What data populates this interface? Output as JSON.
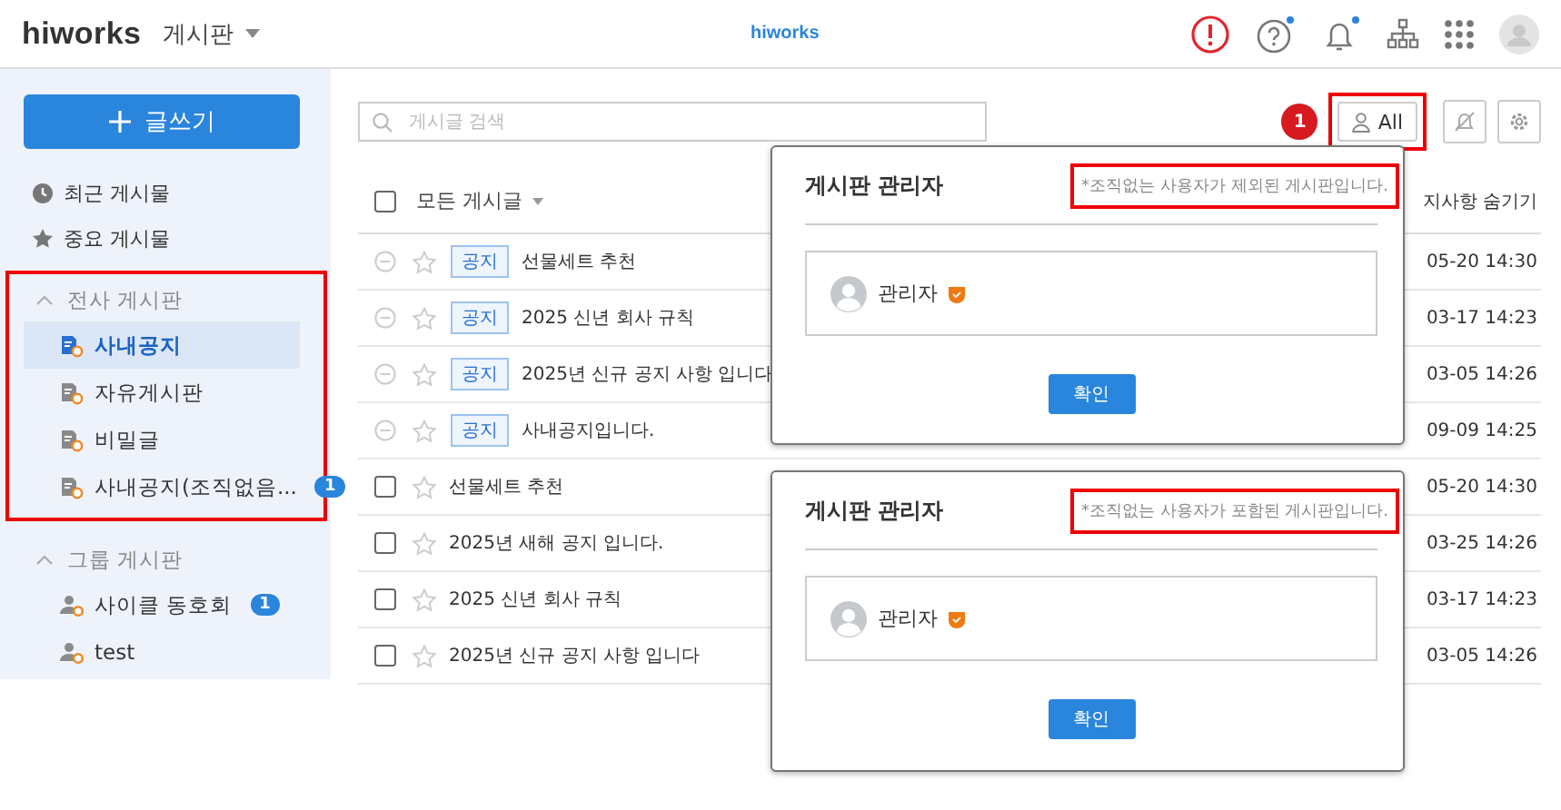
{
  "header": {
    "logo": "hiworks",
    "app_menu": "게시판",
    "center_logo": "hiworks",
    "icons": [
      {
        "kind": "alert"
      },
      {
        "kind": "help",
        "dot": true
      },
      {
        "kind": "bell",
        "dot": true
      },
      {
        "kind": "org"
      },
      {
        "kind": "apps"
      },
      {
        "kind": "avatar"
      }
    ]
  },
  "sidebar": {
    "write_button": "글쓰기",
    "shortcuts": [
      {
        "kind": "recent",
        "label": "최근 게시물"
      },
      {
        "kind": "important",
        "label": "중요 게시물"
      }
    ],
    "groups": [
      {
        "label": "전사 게시판",
        "expanded": true,
        "highlighted": true,
        "children": [
          {
            "kind": "board",
            "label": "사내공지",
            "selected": true
          },
          {
            "kind": "board",
            "label": "자유게시판",
            "selected": false
          },
          {
            "kind": "board",
            "label": "비밀글",
            "selected": false
          },
          {
            "kind": "board",
            "label": "사내공지(조직없음...",
            "selected": false,
            "badge": "1"
          }
        ]
      },
      {
        "label": "그룹 게시판",
        "expanded": true,
        "highlighted": false,
        "children": [
          {
            "kind": "group",
            "label": "사이클 동호회",
            "selected": false,
            "badge": "1"
          },
          {
            "kind": "group",
            "label": "test",
            "selected": false
          }
        ]
      }
    ]
  },
  "toolbar": {
    "search": {
      "placeholder": "게시글 검색"
    },
    "step_badge": "1",
    "all_button": {
      "label": "All",
      "highlighted": true
    }
  },
  "table": {
    "filter": "모든 게시글",
    "all_checked": false,
    "column_right": "지사항 숨기기",
    "rows": [
      {
        "kind": "notice",
        "tag": "공지",
        "title": "선물세트 추천",
        "date": "05-20 14:30"
      },
      {
        "kind": "notice",
        "tag": "공지",
        "title": "2025 신년 회사 규칙",
        "date": "03-17 14:23"
      },
      {
        "kind": "notice",
        "tag": "공지",
        "title": "2025년 신규 공지 사항 입니다",
        "date": "03-05 14:26"
      },
      {
        "kind": "notice",
        "tag": "공지",
        "title": "사내공지입니다.",
        "date": "09-09 14:25"
      },
      {
        "kind": "normal",
        "checked": false,
        "title": "선물세트 추천",
        "date": "05-20 14:30"
      },
      {
        "kind": "normal",
        "checked": false,
        "title": "2025년 새해 공지 입니다.",
        "date": "03-25 14:26"
      },
      {
        "kind": "normal",
        "checked": false,
        "title": "2025 신년 회사 규칙",
        "date": "03-17 14:23"
      },
      {
        "kind": "normal",
        "checked": false,
        "title": "2025년 신규 공지 사항 입니다",
        "date": "03-05 14:26"
      }
    ]
  },
  "popovers": [
    {
      "title": "게시판 관리자",
      "note": "*조직없는 사용자가 제외된 게시판입니다.",
      "note_highlighted": true,
      "admins": [
        {
          "name": "관리자"
        }
      ],
      "button": "확인"
    },
    {
      "title": "게시판 관리자",
      "note": "*조직없는 사용자가 포함된 게시판입니다.",
      "note_highlighted": true,
      "admins": [
        {
          "name": "관리자"
        }
      ],
      "button": "확인"
    }
  ]
}
